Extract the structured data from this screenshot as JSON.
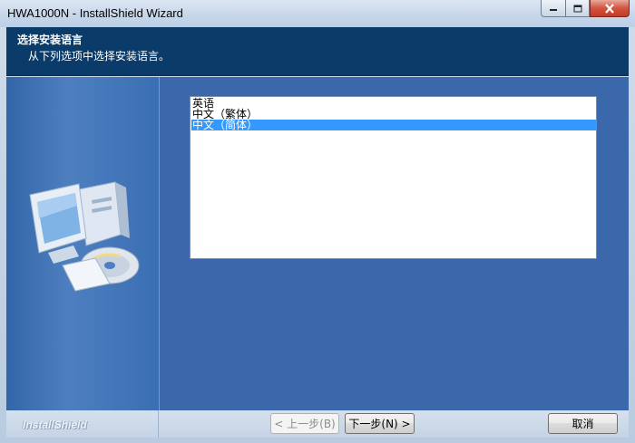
{
  "window": {
    "title": "HWA1000N - InstallShield Wizard"
  },
  "header": {
    "title": "选择安装语言",
    "subtitle": "从下列选项中选择安装语言。"
  },
  "languages": [
    {
      "label": "英语",
      "selected": false
    },
    {
      "label": "中文（繁体）",
      "selected": false
    },
    {
      "label": "中文（简体）",
      "selected": true
    }
  ],
  "footer": {
    "brand": "InstallShield",
    "back_label": "< 上一步(B)",
    "next_label": "下一步(N) >",
    "cancel_label": "取消"
  },
  "colors": {
    "banner": "#0b3b69",
    "body": "#3a68aa",
    "selection": "#3399ff"
  },
  "icons": {
    "minimize": "minimize-icon",
    "maximize": "maximize-icon",
    "close": "close-icon",
    "computer": "computer-with-cd-icon"
  }
}
